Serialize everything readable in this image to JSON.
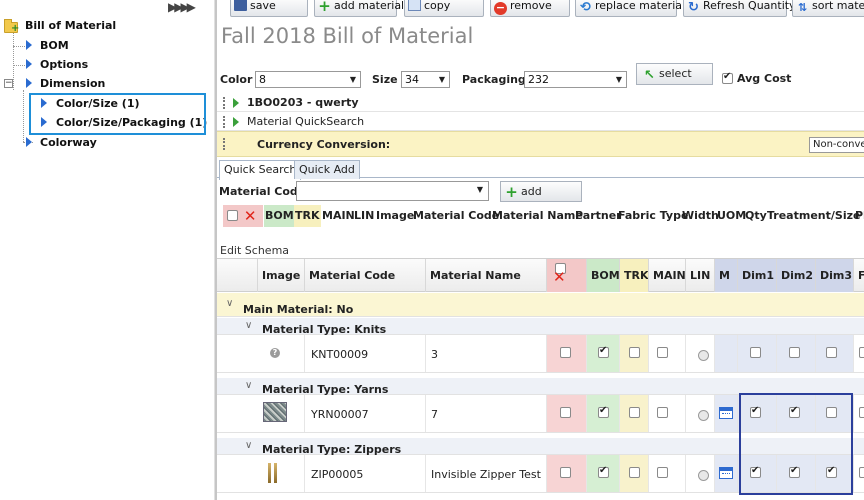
{
  "tree": {
    "collapse_glyph": "▶▶▶▶",
    "root_label": "Bill of Material",
    "items": [
      {
        "label": "BOM"
      },
      {
        "label": "Options"
      },
      {
        "label": "Dimension"
      },
      {
        "label": "Color/Size (1)"
      },
      {
        "label": "Color/Size/Packaging (1)"
      },
      {
        "label": "Colorway"
      }
    ]
  },
  "toolbar": {
    "save": "save",
    "add_material": "add material",
    "copy": "copy",
    "remove": "remove",
    "replace_material": "replace material",
    "refresh_quantity": "Refresh Quantity",
    "sort_material": "sort mater"
  },
  "page_title": "Fall 2018 Bill of Material",
  "filters": {
    "color_label": "Color",
    "color_value": "8",
    "size_label": "Size",
    "size_value": "34",
    "packaging_label": "Packaging",
    "packaging_value": "232",
    "select_button": "select",
    "avg_cost_label": "Avg Cost",
    "avg_cost_checked": true
  },
  "sections": {
    "style_row": "1BO0203 - qwerty",
    "quick_search_row": "Material QuickSearch",
    "currency_label": "Currency Conversion:",
    "currency_value": "Non-conve"
  },
  "tabs": [
    "Quick Search",
    "Quick Add"
  ],
  "quick_search": {
    "material_code_label": "Material Code",
    "add_button": "add",
    "columns": [
      "BOM",
      "TRK",
      "MAIN",
      "LIN",
      "Image",
      "Material Code",
      "Material Name",
      "Partner",
      "Fabric Type",
      "Width",
      "UOM",
      "Qty",
      "Treatment/Size",
      "Pl"
    ]
  },
  "edit_schema": "Edit Schema",
  "grid": {
    "headers": {
      "image": "Image",
      "material_code": "Material Code",
      "material_name": "Material Name",
      "bom": "BOM",
      "trk": "TRK",
      "main": "MAIN",
      "lin": "LIN",
      "m": "M",
      "dim1": "Dim1",
      "dim2": "Dim2",
      "dim3": "Dim3",
      "extra": "F"
    },
    "main_group": "Main Material: No",
    "groups": [
      {
        "type_label": "Material Type: Knits",
        "code": "KNT00009",
        "name": "3",
        "bom": true,
        "trk": false,
        "main": false,
        "dim1": false,
        "dim2": false,
        "dim3": false
      },
      {
        "type_label": "Material Type: Yarns",
        "code": "YRN00007",
        "name": "7",
        "bom": true,
        "trk": false,
        "main": false,
        "dim1": true,
        "dim2": true,
        "dim3": false
      },
      {
        "type_label": "Material Type: Zippers",
        "code": "ZIP00005",
        "name": "Invisible Zipper Test",
        "bom": true,
        "trk": false,
        "main": false,
        "dim1": true,
        "dim2": true,
        "dim3": true
      }
    ]
  },
  "colors": {
    "highlight_blue": "#1e8fd8",
    "highlight_navy": "#2b3f9c",
    "title_gray": "#8a8a8a",
    "currency_bg": "#fbf3c4"
  }
}
